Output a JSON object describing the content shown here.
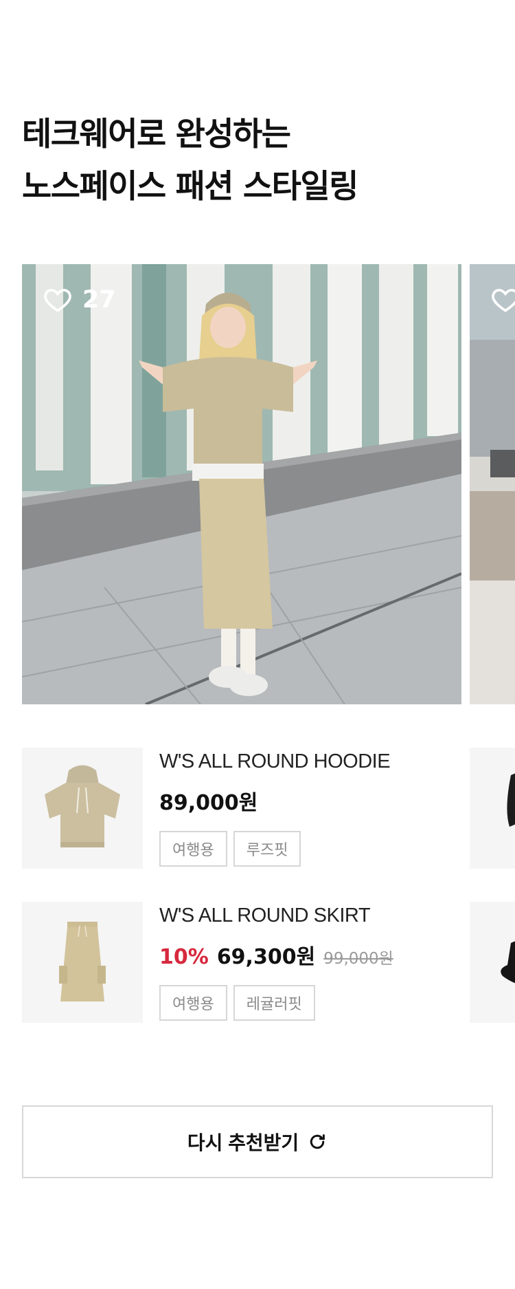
{
  "section": {
    "title_line1": "테크웨어로 완성하는",
    "title_line2": "노스페이스 패션 스타일링"
  },
  "carousel": {
    "slides": [
      {
        "like_count": "27",
        "icon": "heart-outline-icon"
      },
      {
        "icon": "heart-outline-icon"
      }
    ]
  },
  "products": [
    {
      "name": "W'S ALL ROUND HOODIE",
      "price": "89,000원",
      "tags": [
        "여행용",
        "루즈핏"
      ]
    },
    {
      "name": "W'S ALL ROUND SKIRT",
      "discount": "10%",
      "price": "69,300원",
      "original_price": "99,000원",
      "tags": [
        "여행용",
        "레귤러핏"
      ]
    }
  ],
  "refresh_button": {
    "label": "다시 추천받기",
    "icon": "refresh-icon"
  },
  "colors": {
    "discount": "#d6293e",
    "text": "#111111",
    "tag_border": "#d6d6d6",
    "thumb_bg": "#f5f5f5"
  }
}
